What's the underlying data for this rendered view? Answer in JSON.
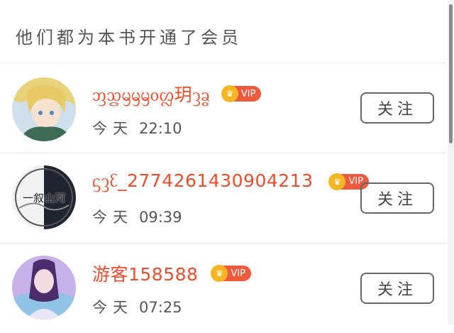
{
  "header": {
    "title": "他们都为本书开通了会员"
  },
  "members": [
    {
      "name": "ᦀᦪᦙᦙᦙᦞᦜ玥ᦡᦧ",
      "vip": "VIP",
      "day": "今天",
      "time": "22:10",
      "follow": "关注"
    },
    {
      "name": "ᦓᦡᦷ_2774261430904213",
      "vip": "VIP",
      "day": "今天",
      "time": "09:39",
      "follow": "关注"
    },
    {
      "name": "游客158588",
      "vip": "VIP",
      "day": "今天",
      "time": "07:25",
      "follow": "关注"
    }
  ],
  "avatar_text": {
    "he": "一叙山河"
  },
  "colors": {
    "accent": "#ee4d2e",
    "crown": "#f6b623",
    "badge": "#ef5a3f"
  },
  "icons": {
    "crown": "crown-icon"
  }
}
